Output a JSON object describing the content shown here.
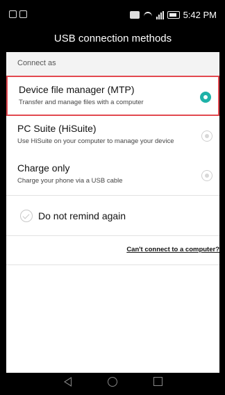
{
  "status_bar": {
    "time": "5:42 PM",
    "left_icons": [
      "gallery-notification-icon",
      "cloud-notification-icon"
    ],
    "right_icons": [
      "nfc-icon",
      "wifi-icon",
      "signal-icon",
      "battery-icon"
    ]
  },
  "title": "USB connection methods",
  "section_label": "Connect as",
  "options": [
    {
      "title": "Device file manager (MTP)",
      "description": "Transfer and manage files with a computer",
      "selected": true
    },
    {
      "title": "PC Suite (HiSuite)",
      "description": "Use HiSuite on your computer to manage your device",
      "selected": false
    },
    {
      "title": "Charge only",
      "description": "Charge your phone via a USB cable",
      "selected": false
    }
  ],
  "remind_label": "Do not remind again",
  "help_link": "Can't connect to a computer?",
  "colors": {
    "accent": "#1fb2a8",
    "highlight_border": "#e2484f"
  },
  "nav": [
    "back-icon",
    "home-icon",
    "recents-icon"
  ]
}
